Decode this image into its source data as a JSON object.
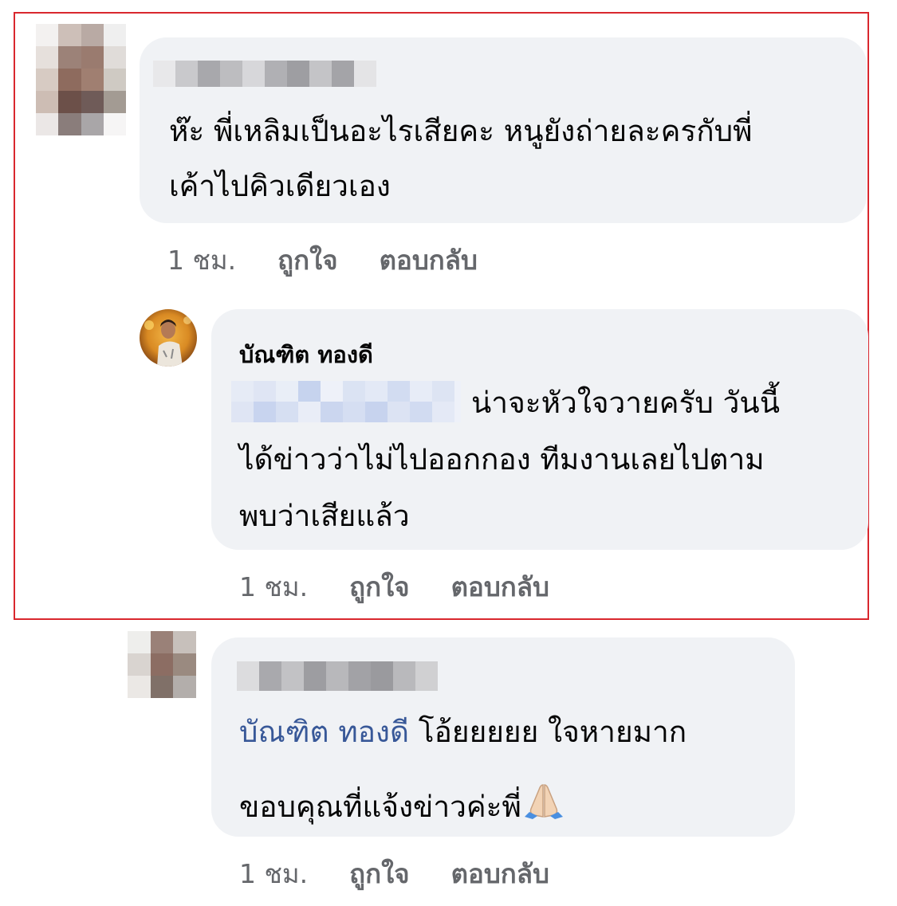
{
  "colors": {
    "highlight_border": "#d9272e",
    "bubble_bg": "#f0f2f5",
    "meta_text": "#65676b",
    "mention": "#385898"
  },
  "comments": [
    {
      "author": "",
      "author_hidden": true,
      "text_lines": [
        "ห๊ะ พี่เหลิมเป็นอะไรเสียคะ หนูยังถ่ายละครกับพี่",
        "เค้าไปคิวเดียวเอง"
      ],
      "time": "1 ชม.",
      "like_label": "ถูกใจ",
      "reply_label": "ตอบกลับ"
    },
    {
      "author": "บัณฑิต ทองดี",
      "author_hidden": false,
      "text_lines": [
        "น่าจะหัวใจวายครับ วันนี้",
        "ได้ข่าวว่าไม่ไปออกกอง ทีมงานเลยไปตาม",
        "พบว่าเสียแล้ว"
      ],
      "time": "1 ชม.",
      "like_label": "ถูกใจ",
      "reply_label": "ตอบกลับ"
    },
    {
      "author": "",
      "author_hidden": true,
      "mention": "บัณฑิต ทองดี",
      "text_lines": [
        " โอ้ยยยยย ใจหายมาก",
        "ขอบคุณที่แจ้งข่าวค่ะพี่"
      ],
      "emoji": "folded-hands-icon",
      "time": "1 ชม.",
      "like_label": "ถูกใจ",
      "reply_label": "ตอบกลับ"
    }
  ]
}
